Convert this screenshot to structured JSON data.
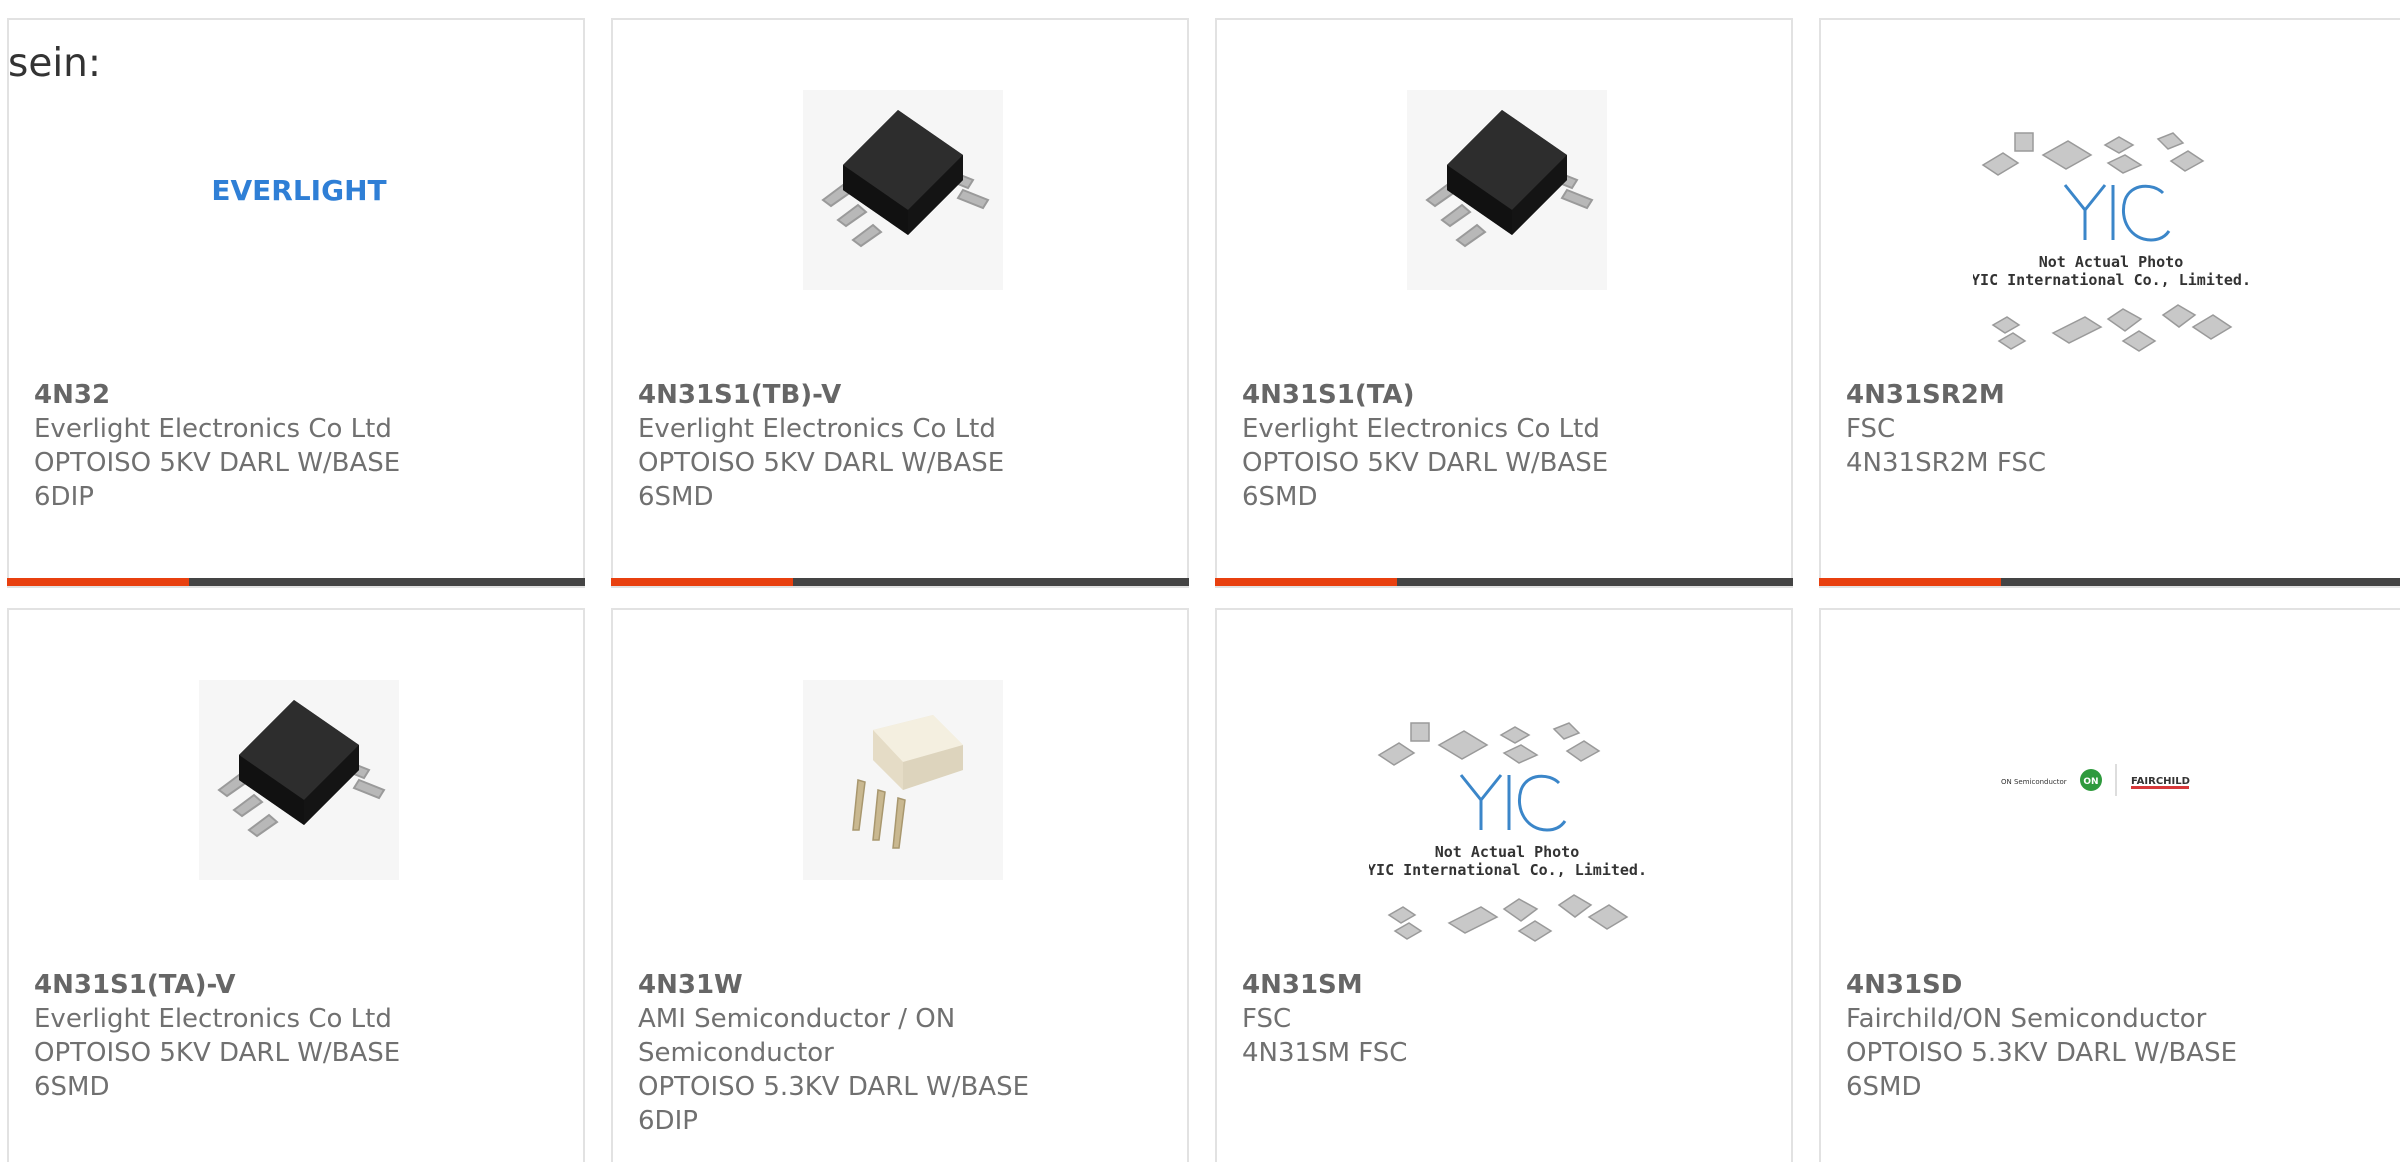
{
  "intro_text": "sein:",
  "colors": {
    "accent": "#e8400f",
    "bar": "#444444",
    "border": "#e2e2e2",
    "text": "#707070"
  },
  "cards": [
    {
      "part": "4N32",
      "manufacturer": "Everlight Electronics Co Ltd",
      "description": "OPTOISO 5KV DARL W/BASE",
      "package": "6DIP",
      "image": "everlight-logo",
      "logo_text": "EVERLIGHT"
    },
    {
      "part": "4N31S1(TB)-V",
      "manufacturer": "Everlight Electronics Co Ltd",
      "description": "OPTOISO 5KV DARL W/BASE",
      "package": "6SMD",
      "image": "smd-chip"
    },
    {
      "part": "4N31S1(TA)",
      "manufacturer": "Everlight Electronics Co Ltd",
      "description": "OPTOISO 5KV DARL W/BASE",
      "package": "6SMD",
      "image": "smd-chip"
    },
    {
      "part": "4N31SR2M",
      "manufacturer": "FSC",
      "description": "4N31SR2M FSC",
      "package": "",
      "image": "yic-placeholder",
      "logo_text": "YIC",
      "caption1": "Not Actual Photo",
      "caption2": "YIC International Co., Limited."
    },
    {
      "part": "4N31S1(TA)-V",
      "manufacturer": "Everlight Electronics Co Ltd",
      "description": "OPTOISO 5KV DARL W/BASE",
      "package": "6SMD",
      "image": "smd-chip"
    },
    {
      "part": "4N31W",
      "manufacturer": "AMI Semiconductor / ON Semiconductor",
      "description": "OPTOISO 5.3KV DARL W/BASE",
      "package": "6DIP",
      "image": "dip-chip"
    },
    {
      "part": "4N31SM",
      "manufacturer": "FSC",
      "description": "4N31SM FSC",
      "package": "",
      "image": "yic-placeholder",
      "logo_text": "YIC",
      "caption1": "Not Actual Photo",
      "caption2": "YIC International Co., Limited."
    },
    {
      "part": "4N31SD",
      "manufacturer": "Fairchild/ON Semiconductor",
      "description": "OPTOISO 5.3KV DARL W/BASE",
      "package": "6SMD",
      "image": "onsemi-fairchild-logo",
      "logo_text": "ON Semiconductor",
      "logo_text2": "FAIRCHILD"
    }
  ]
}
